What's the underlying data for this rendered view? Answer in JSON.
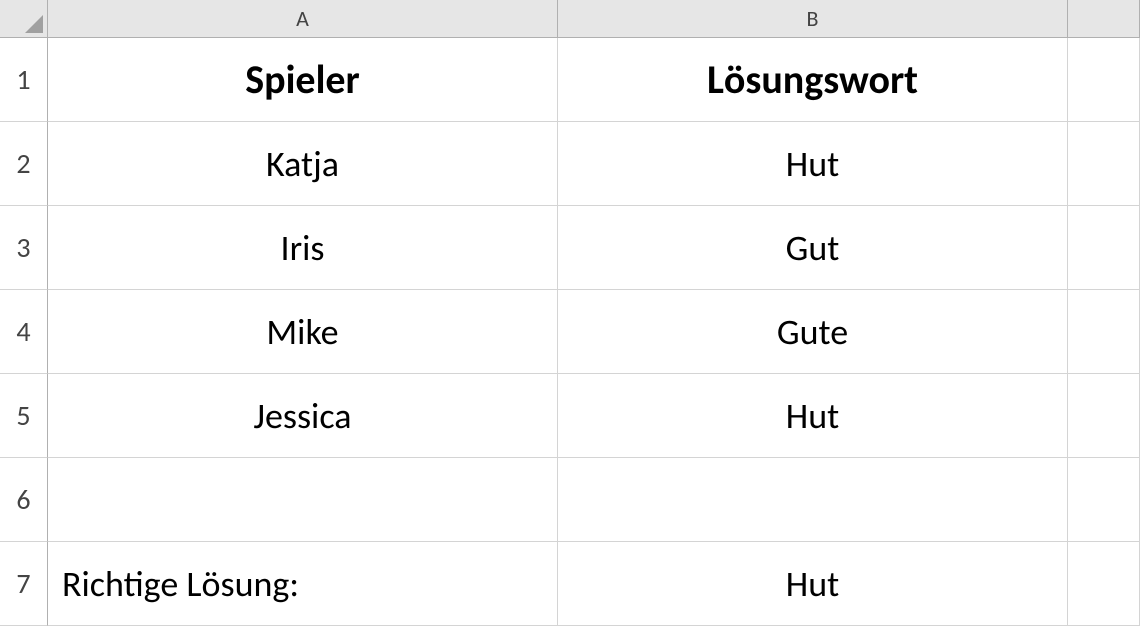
{
  "columns": [
    "A",
    "B",
    ""
  ],
  "row_numbers": [
    "1",
    "2",
    "3",
    "4",
    "5",
    "6",
    "7"
  ],
  "header": {
    "colA": "Spieler",
    "colB": "Lösungswort"
  },
  "rows": [
    {
      "player": "Katja",
      "word": "Hut"
    },
    {
      "player": "Iris",
      "word": "Gut"
    },
    {
      "player": "Mike",
      "word": "Gute"
    },
    {
      "player": "Jessica",
      "word": "Hut"
    }
  ],
  "blank": "",
  "solution": {
    "label": "Richtige Lösung:",
    "value": "Hut"
  }
}
